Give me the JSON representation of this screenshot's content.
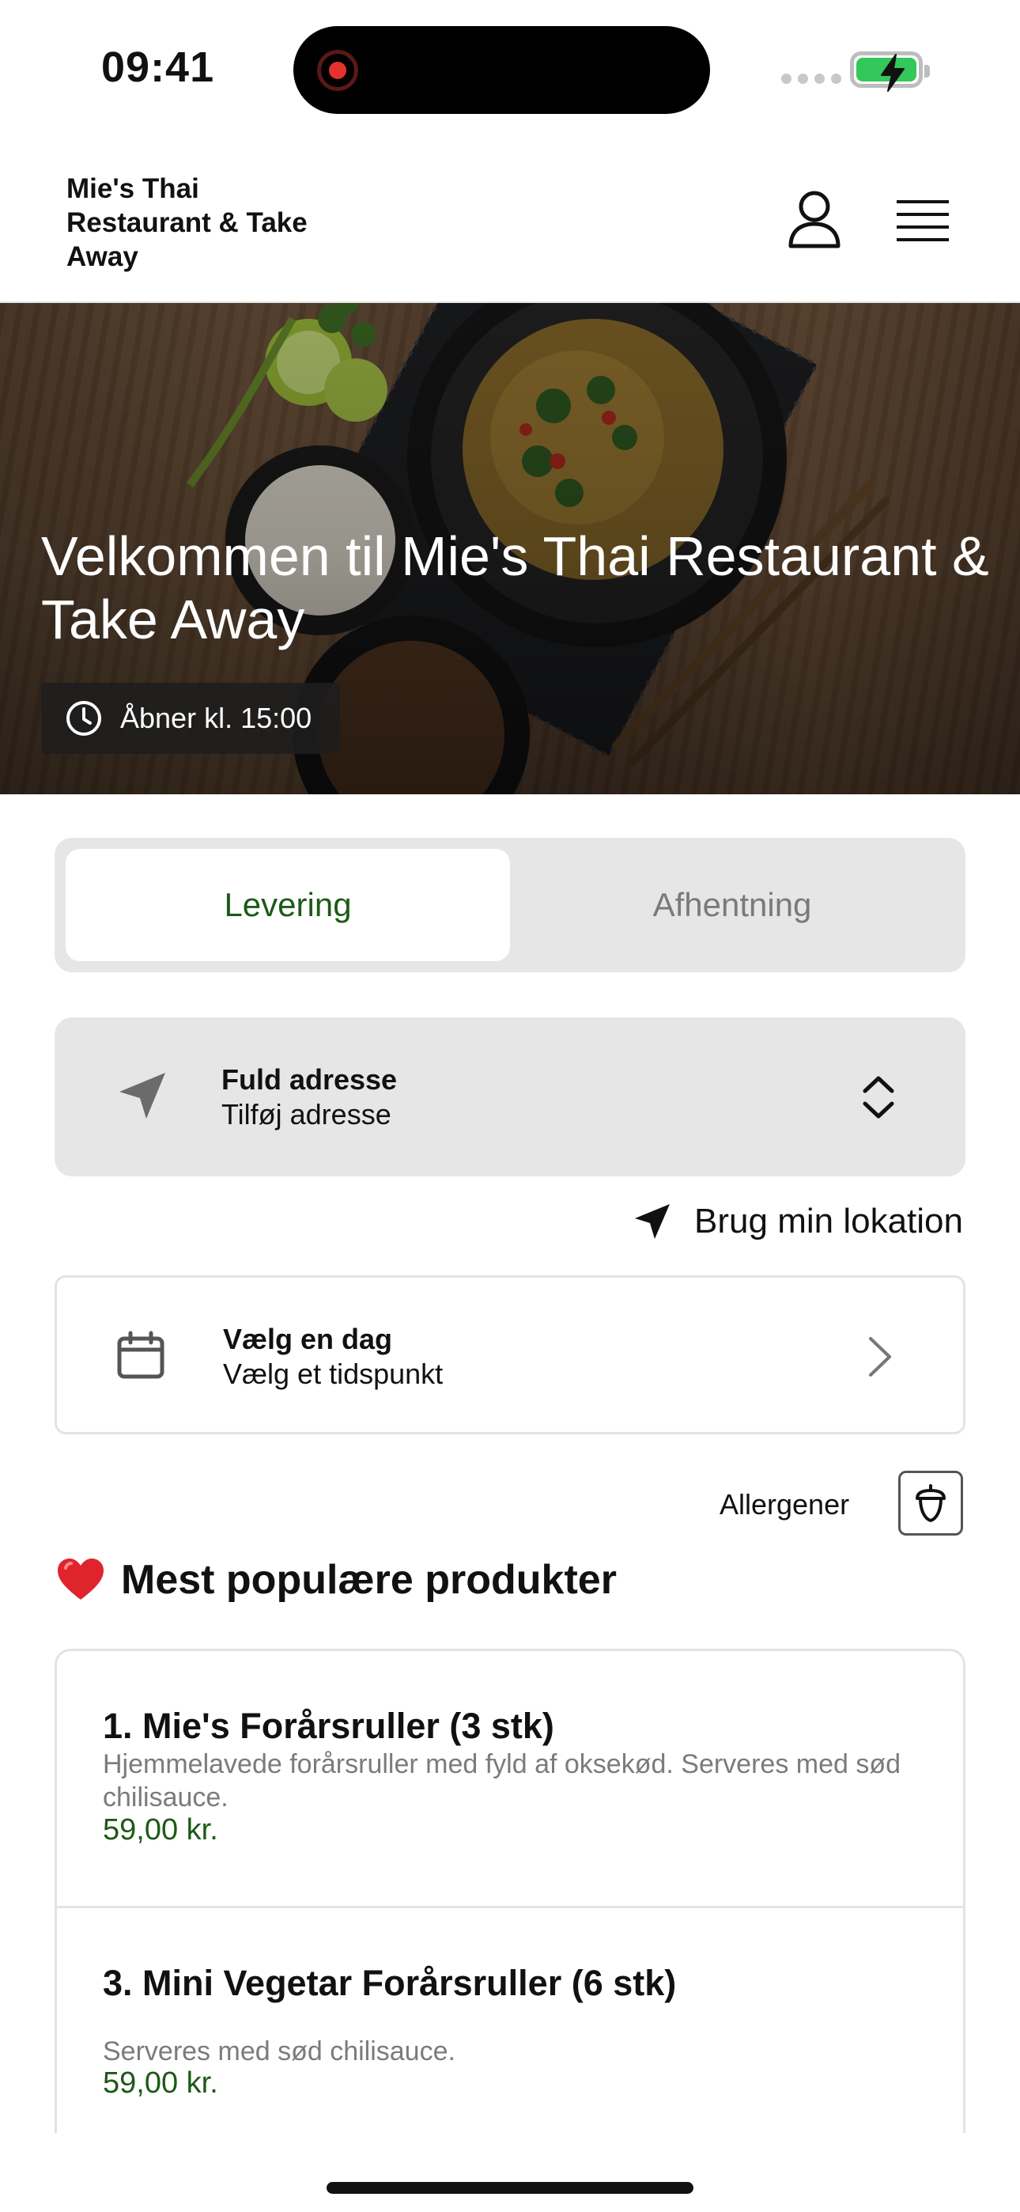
{
  "status_bar": {
    "time": "09:41",
    "recording_icon": "screen-recording-icon",
    "signal_icon": "cellular-signal-icon",
    "battery_icon": "battery-charging-icon"
  },
  "header": {
    "restaurant_name": "Mie's Thai Restaurant & Take Away",
    "account_icon": "user-icon",
    "menu_icon": "hamburger-menu-icon"
  },
  "hero": {
    "title": "Velkommen til Mie's Thai Restaurant & Take Away",
    "opening_icon": "clock-icon",
    "opening_text": "Åbner kl. 15:00"
  },
  "order_type": {
    "tabs": [
      {
        "label": "Levering",
        "selected": true
      },
      {
        "label": "Afhentning",
        "selected": false
      }
    ]
  },
  "address": {
    "icon": "navigation-arrow-icon",
    "title": "Fuld adresse",
    "subtitle": "Tilføj adresse",
    "toggle_icon": "chevron-up-down-icon"
  },
  "use_location": {
    "icon": "location-arrow-icon",
    "label": "Brug min lokation"
  },
  "schedule": {
    "icon": "calendar-icon",
    "title": "Vælg en dag",
    "subtitle": "Vælg et tidspunkt",
    "chevron_icon": "chevron-right-icon"
  },
  "allergens": {
    "label": "Allergener",
    "icon": "acorn-icon"
  },
  "popular": {
    "icon": "heart-icon",
    "title": "Mest populære produkter",
    "products": [
      {
        "name": "1. Mie's Forårsruller (3 stk)",
        "description": "Hjemmelavede forårsruller med fyld af oksekød. Serveres med sød chilisauce.",
        "price": "59,00 kr."
      },
      {
        "name": "3. Mini Vegetar Forårsruller (6 stk)",
        "description": "Serveres med sød chilisauce.",
        "price": "59,00 kr."
      }
    ]
  },
  "colors": {
    "accent_green": "#1d5a16",
    "panel_gray": "#e6e6e6",
    "battery_green": "#34c759"
  }
}
